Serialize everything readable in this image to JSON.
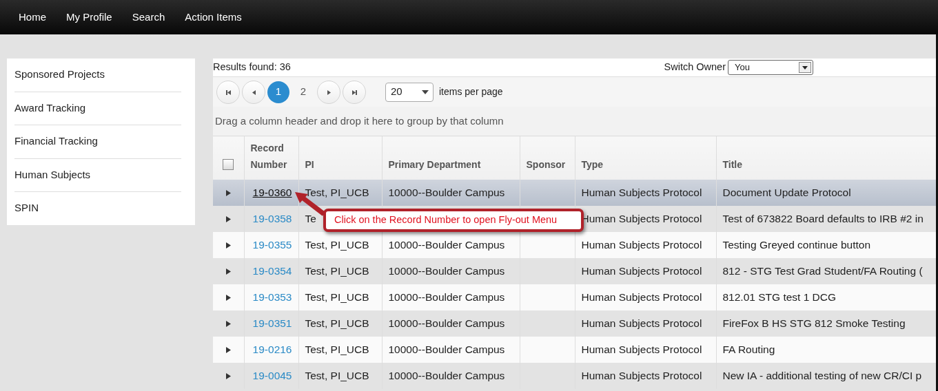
{
  "nav": [
    {
      "label": "Home"
    },
    {
      "label": "My Profile"
    },
    {
      "label": "Search"
    },
    {
      "label": "Action Items"
    }
  ],
  "sidebar": {
    "items": [
      {
        "label": "Sponsored Projects"
      },
      {
        "label": "Award Tracking"
      },
      {
        "label": "Financial Tracking"
      },
      {
        "label": "Human Subjects"
      },
      {
        "label": "SPIN"
      }
    ]
  },
  "results": {
    "text": "Results found: 36",
    "switch_owner_label": "Switch Owner",
    "switch_owner_value": "You"
  },
  "pager": {
    "pages": [
      {
        "label": "1",
        "selected": true
      },
      {
        "label": "2",
        "selected": false
      }
    ],
    "per_page": "20",
    "per_page_label": "items per page"
  },
  "group_hint": "Drag a column header and drop it here to group by that column",
  "table": {
    "select_all_checked": false,
    "columns": [
      "Record Number",
      "PI",
      "Primary Department",
      "Sponsor",
      "Type",
      "Title"
    ],
    "rows": [
      {
        "record": "19-0360",
        "pi": "Test, PI_UCB",
        "department": "10000--Boulder Campus",
        "type": "Human Subjects Protocol",
        "title": "Document Update Protocol",
        "selected": true
      },
      {
        "record": "19-0358",
        "pi": "Te",
        "type": "Human Subjects Protocol",
        "title": "Test of 673822 Board defaults to IRB #2 in",
        "selected": false
      },
      {
        "record": "19-0355",
        "pi": "Test, PI_UCB",
        "department": "10000--Boulder Campus",
        "type": "Human Subjects Protocol",
        "title": "Testing Greyed continue button",
        "selected": false
      },
      {
        "record": "19-0354",
        "pi": "Test, PI_UCB",
        "department": "10000--Boulder Campus",
        "type": "Human Subjects Protocol",
        "title": "812 - STG Test Grad Student/FA Routing (",
        "selected": false
      },
      {
        "record": "19-0353",
        "pi": "Test, PI_UCB",
        "department": "10000--Boulder Campus",
        "type": "Human Subjects Protocol",
        "title": "812.01 STG test 1 DCG",
        "selected": false
      },
      {
        "record": "19-0351",
        "pi": "Test, PI_UCB",
        "department": "10000--Boulder Campus",
        "type": "Human Subjects Protocol",
        "title": "FireFox B HS STG 812 Smoke Testing",
        "selected": false
      },
      {
        "record": "19-0216",
        "pi": "Test, PI_UCB",
        "department": "10000--Boulder Campus",
        "type": "Human Subjects Protocol",
        "title": "FA Routing",
        "selected": false
      },
      {
        "record": "19-0045",
        "pi": "Test, PI_UCB",
        "department": "10000--Boulder Campus",
        "type": "Human Subjects Protocol",
        "title": "New IA - additional testing of new CR/CI p",
        "selected": false
      }
    ]
  },
  "callout": {
    "text": "Click on the Record Number to open Fly-out Menu"
  }
}
